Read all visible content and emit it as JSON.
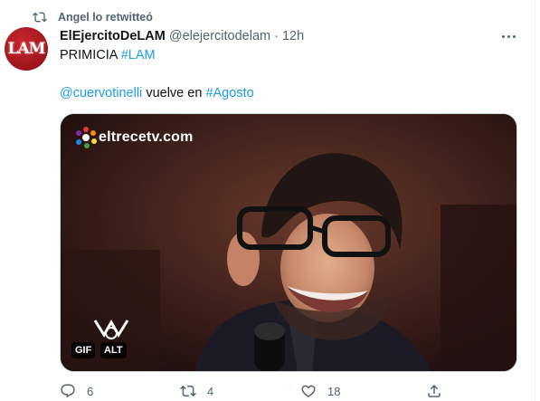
{
  "retweet_context": {
    "text": "Angel lo retwitteó",
    "icon": "retweet-icon"
  },
  "author": {
    "display_name": "ElEjercitoDeLAM",
    "handle": "@elejercitodelam",
    "separator": "·",
    "time": "12h",
    "avatar_text": "LAM"
  },
  "tweet": {
    "line1_prefix": "PRIMICIA ",
    "line1_hashtag": "#LAM",
    "line2_mention": "@cuervotinelli",
    "line2_middle": " vuelve en ",
    "line2_hashtag": "#Agosto"
  },
  "media": {
    "watermark": "eltrecetv.com",
    "gif_label": "GIF",
    "alt_label": "ALT"
  },
  "actions": {
    "reply_count": "6",
    "retweet_count": "4",
    "like_count": "18"
  },
  "colors": {
    "link": "#1d9bf0",
    "secondary_text": "#536471",
    "avatar_bg": "#b71c22"
  }
}
